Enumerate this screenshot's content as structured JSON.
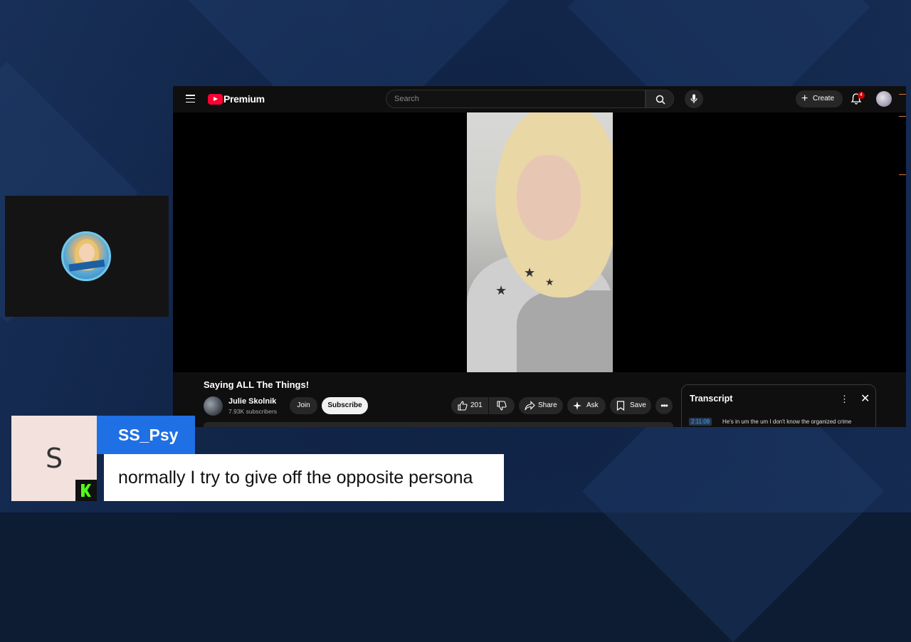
{
  "youtube": {
    "logo_text": "Premium",
    "search_placeholder": "Search",
    "create_label": "Create",
    "notification_count": "4",
    "video_title": "Saying ALL The Things!",
    "channel_name": "Julie Skolnik",
    "subscriber_count": "7.93K subscribers",
    "join_label": "Join",
    "subscribe_label": "Subscribe",
    "like_count": "201",
    "share_label": "Share",
    "ask_label": "Ask",
    "save_label": "Save",
    "transcript": {
      "title": "Transcript",
      "timestamp": "2:11:09",
      "text": "He's in um the um I don't know the organized crime"
    }
  },
  "overlay": {
    "user_initial": "S",
    "username": "SS_Psy",
    "caption": "normally I try to give off the opposite persona",
    "accent_color": "#1f6fe5",
    "platform_icon": "kick-icon"
  }
}
